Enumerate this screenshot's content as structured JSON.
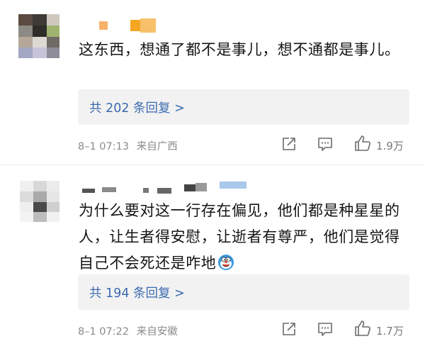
{
  "comments": [
    {
      "text": "这东西，想通了都不是事儿，想不通都是事儿。",
      "reply_label": "共 202 条回复 >",
      "timestamp": "8–1 07:13",
      "location": "来自广西",
      "like_count": "1.9万"
    },
    {
      "text": "为什么要对这一行存在偏见，他们都是种星星的人，让生者得安慰，让逝者有尊严，他们是觉得自己不会死还是咋地",
      "reply_label": "共 194 条回复 >",
      "timestamp": "8–1 07:22",
      "location": "来自安徽",
      "like_count": "1.7万"
    }
  ],
  "colors": {
    "link": "#3c6bb0",
    "meta": "#8b8b8b",
    "reply_bg": "#f2f2f2"
  },
  "icons": [
    "share-icon",
    "comment-icon",
    "like-icon",
    "emoji-icon"
  ]
}
